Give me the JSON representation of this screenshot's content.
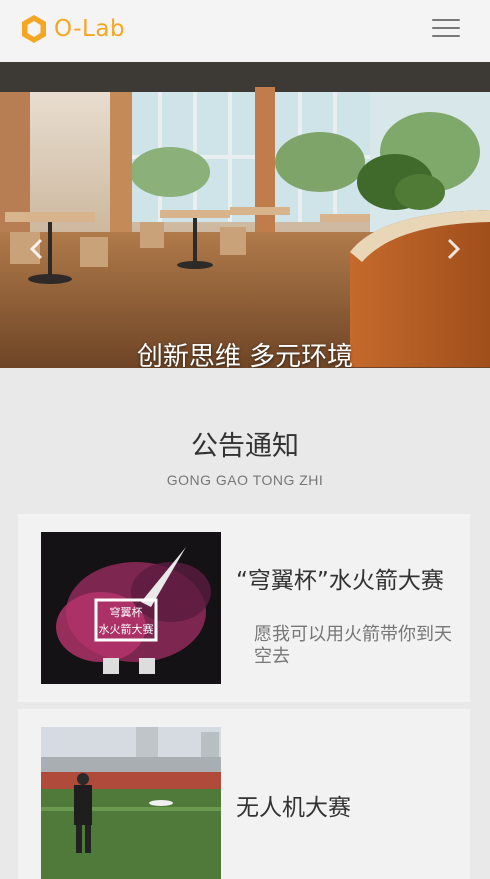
{
  "header": {
    "logo_text": "O-Lab",
    "brand_color": "#f5a623",
    "menu_icon": "hamburger-menu-icon"
  },
  "hero": {
    "caption": "创新思维 多元环境",
    "prev_icon": "chevron-left-icon",
    "next_icon": "chevron-right-icon"
  },
  "section": {
    "title": "公告通知",
    "subtitle": "GONG GAO TONG ZHI"
  },
  "notices": [
    {
      "title": "“穹翼杯”水火箭大赛",
      "description": "愿我可以用火箭带你到天空去",
      "poster_texts": [
        "穹翼杯",
        "水火箭大赛"
      ]
    },
    {
      "title": "无人机大赛",
      "description": ""
    }
  ]
}
